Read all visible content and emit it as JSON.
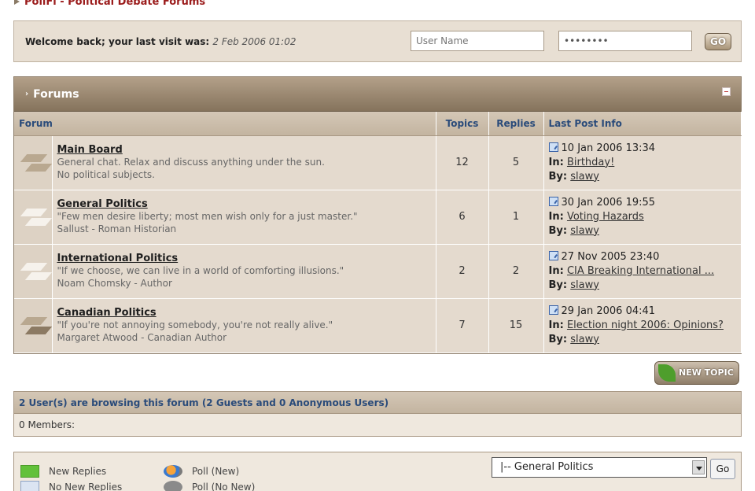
{
  "breadcrumb": {
    "title": "PoliFi - Political Debate Forums"
  },
  "login": {
    "welcome": "Welcome back; your last visit was:",
    "last_visit": "2 Feb 2006 01:02",
    "username_placeholder": "User Name",
    "password_value": "••••••••",
    "go_label": "GO"
  },
  "forums": {
    "title": "Forums",
    "columns": {
      "forum": "Forum",
      "topics": "Topics",
      "replies": "Replies",
      "last_post": "Last Post Info"
    },
    "in_label": "In:",
    "by_label": "By:",
    "rows": [
      {
        "name": "Main Board",
        "desc1": "General chat. Relax and discuss anything under the sun.",
        "desc2": "No political subjects.",
        "topics": "12",
        "replies": "5",
        "date": "10 Jan 2006 13:34",
        "in": "Birthday!",
        "by": "slawy"
      },
      {
        "name": "General Politics",
        "desc1": "\"Few men desire liberty; most men wish only for a just master.\"",
        "desc2": "Sallust - Roman Historian",
        "topics": "6",
        "replies": "1",
        "date": "30 Jan 2006 19:55",
        "in": "Voting Hazards",
        "by": "slawy"
      },
      {
        "name": "International Politics",
        "desc1": "\"If we choose, we can live in a world of comforting illusions.\"",
        "desc2": "Noam Chomsky - Author",
        "topics": "2",
        "replies": "2",
        "date": "27 Nov 2005 23:40",
        "in": "CIA Breaking International ...",
        "by": "slawy"
      },
      {
        "name": "Canadian Politics",
        "desc1": "\"If you're not annoying somebody, you're not really alive.\"",
        "desc2": "Margaret Atwood - Canadian Author",
        "topics": "7",
        "replies": "15",
        "date": "29 Jan 2006 04:41",
        "in": "Election night 2006: Opinions?",
        "by": "slawy"
      }
    ]
  },
  "new_topic_label": "NEW TOPIC",
  "browsing": {
    "header": "2 User(s) are browsing this forum (2 Guests and 0 Anonymous Users)",
    "members": "0 Members:"
  },
  "legend": {
    "new_replies": "New Replies",
    "no_new_replies": "No New Replies",
    "poll_new": "Poll (New)",
    "poll_no_new": "Poll (No New)",
    "jump_selected": "|-- General Politics",
    "jump_go": "Go"
  }
}
